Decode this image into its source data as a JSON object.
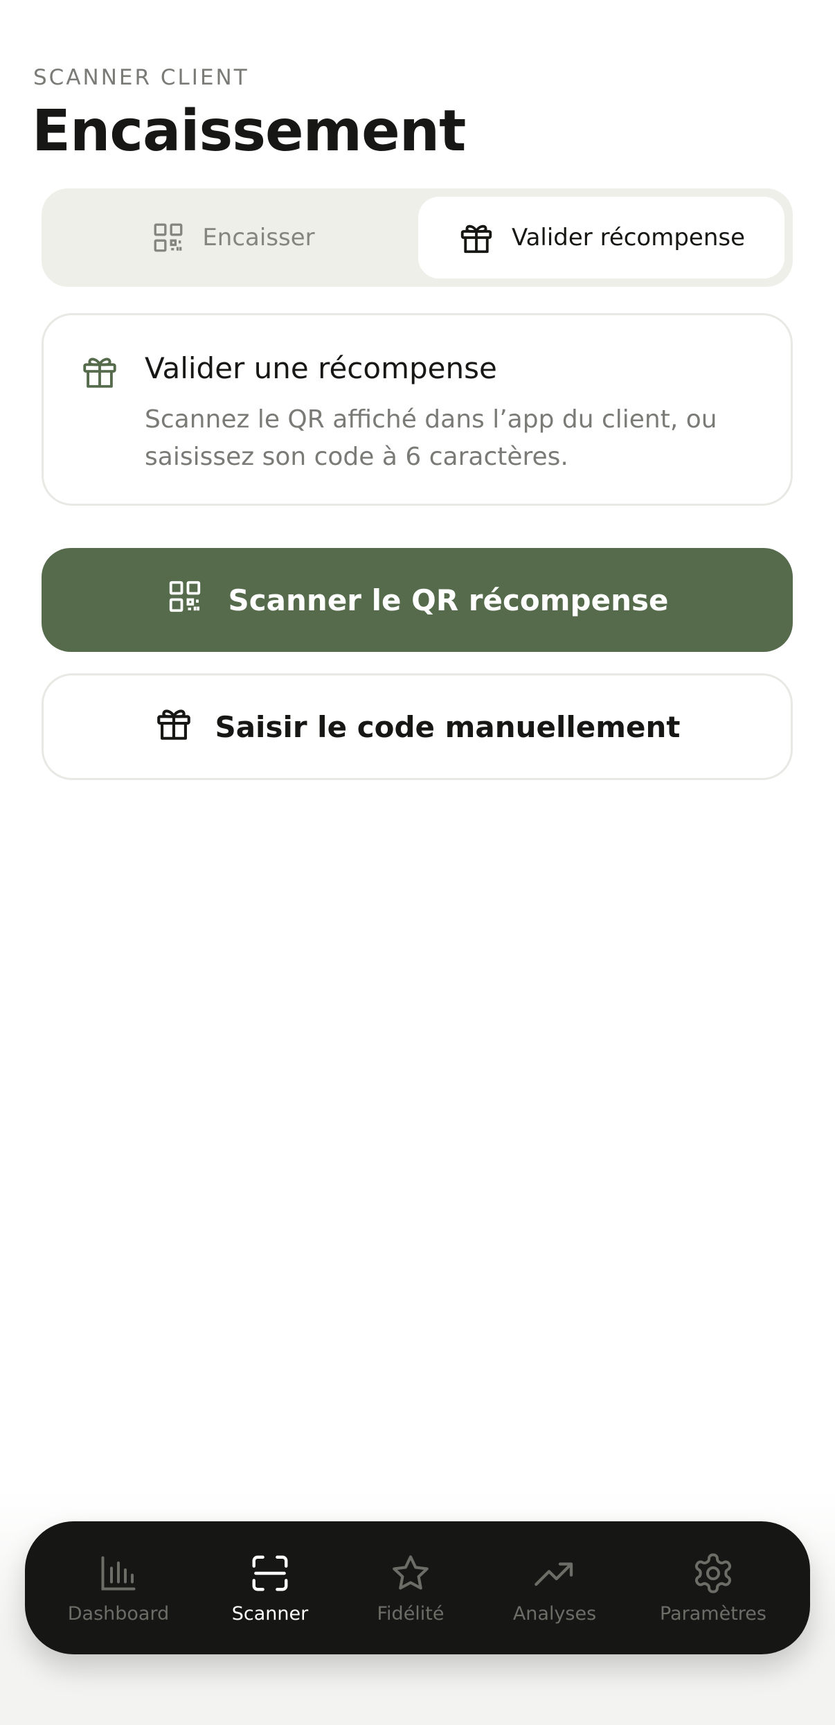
{
  "header": {
    "eyebrow": "SCANNER CLIENT",
    "title": "Encaissement"
  },
  "segmented": {
    "left_label": "Encaisser",
    "right_label": "Valider récompense",
    "selected": "Valider récompense"
  },
  "info_card": {
    "title": "Valider une récompense",
    "description": "Scannez le QR affiché dans l’app du client, ou saisissez son code à 6 caractères."
  },
  "actions": {
    "scan_label": "Scanner le QR récompense",
    "manual_label": "Saisir le code manuellement"
  },
  "tabbar": {
    "items": [
      {
        "label": "Dashboard",
        "icon": "bar-chart-icon"
      },
      {
        "label": "Scanner",
        "icon": "scan-icon"
      },
      {
        "label": "Fidélité",
        "icon": "star-icon"
      },
      {
        "label": "Analyses",
        "icon": "trend-up-icon"
      },
      {
        "label": "Paramètres",
        "icon": "gear-icon"
      }
    ],
    "active": "Scanner"
  },
  "colors": {
    "accent_green": "#556b4c",
    "tabbar_bg": "#161714",
    "segmented_bg": "#efefea"
  }
}
